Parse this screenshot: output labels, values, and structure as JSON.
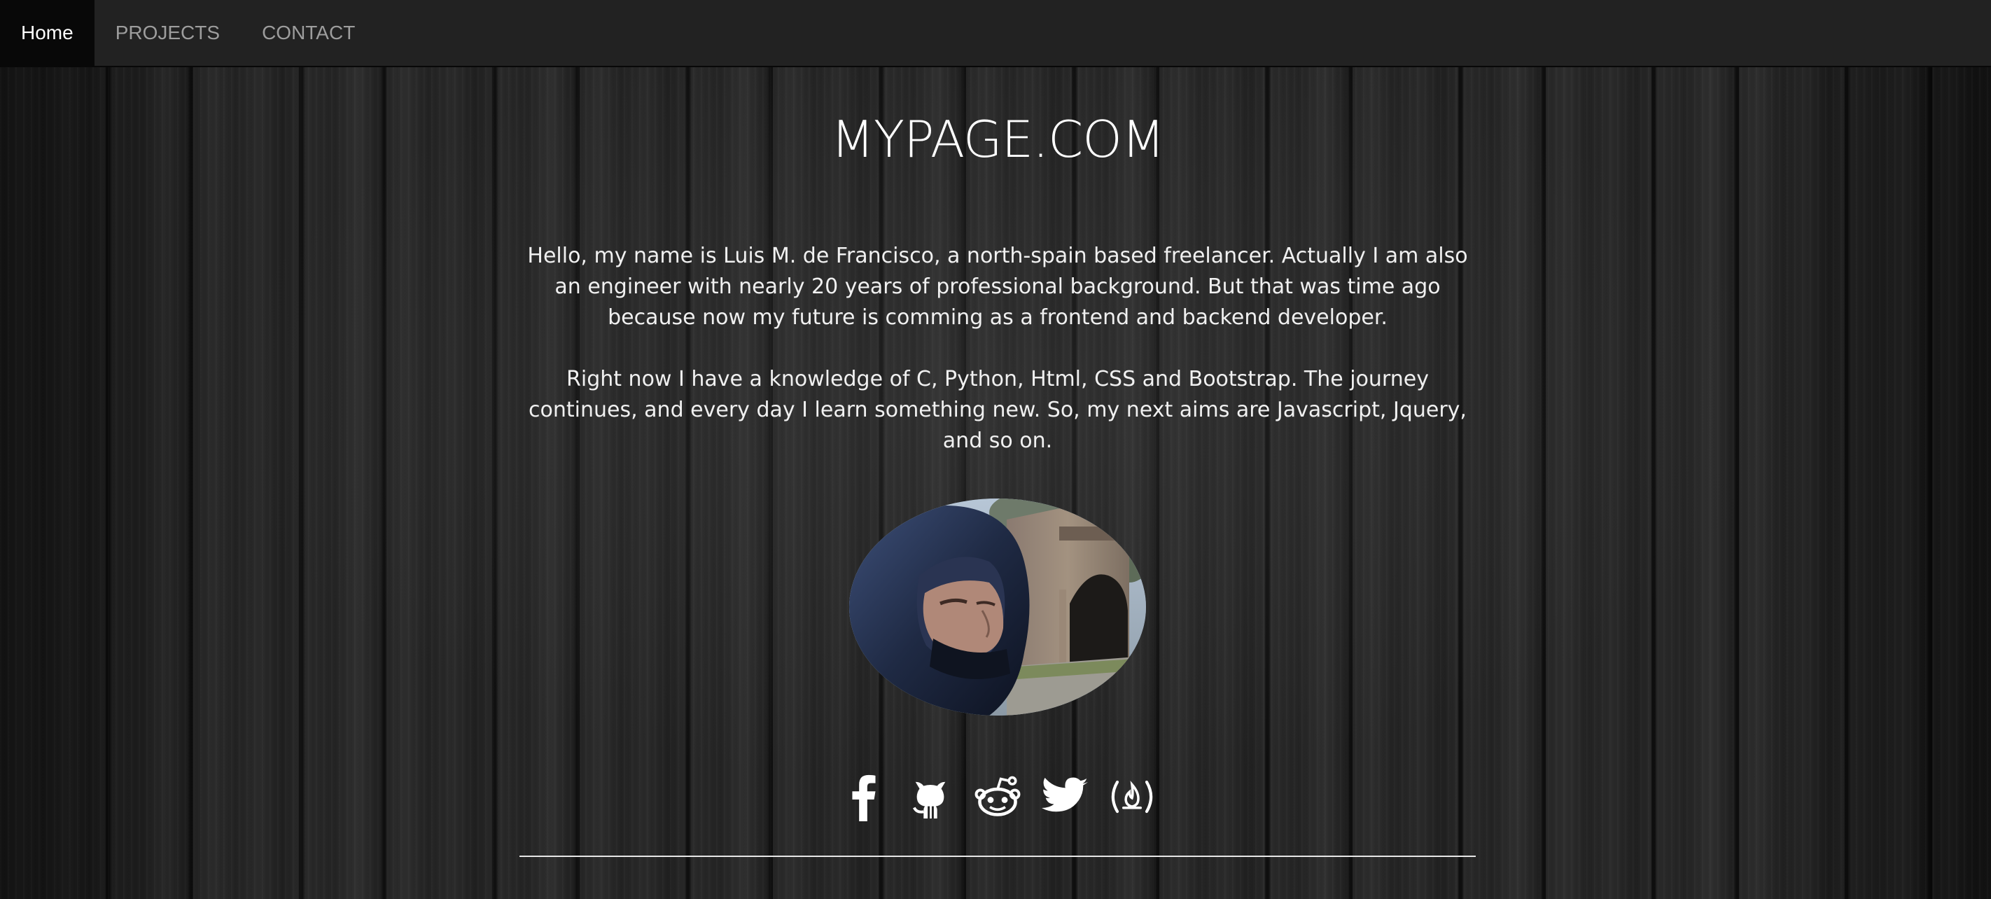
{
  "nav": {
    "items": [
      {
        "label": "Home",
        "active": true
      },
      {
        "label": "PROJECTS",
        "active": false
      },
      {
        "label": "CONTACT",
        "active": false
      }
    ]
  },
  "main": {
    "title": "MYPAGE.COM",
    "paragraphs": [
      "Hello, my name is Luis M. de Francisco, a north-spain based freelancer. Actually I am also an engineer with nearly 20 years of professional background. But that was time ago because now my future is comming as a frontend and backend developer.",
      "Right now I have a knowledge of C, Python, Html, CSS and Bootstrap. The journey continues, and every day I learn something new. So, my next aims are Javascript, Jquery, and so on."
    ],
    "portrait_icon": "profile-photo"
  },
  "social": [
    {
      "icon": "facebook-icon"
    },
    {
      "icon": "github-icon"
    },
    {
      "icon": "reddit-icon"
    },
    {
      "icon": "twitter-icon"
    },
    {
      "icon": "freecodecamp-icon"
    }
  ],
  "colors": {
    "navbar_bg": "#222222",
    "nav_active_bg": "#080808",
    "nav_text": "#9d9d9d",
    "nav_active_text": "#ffffff",
    "text": "#f2f2f2",
    "divider": "#e6e6e6"
  }
}
